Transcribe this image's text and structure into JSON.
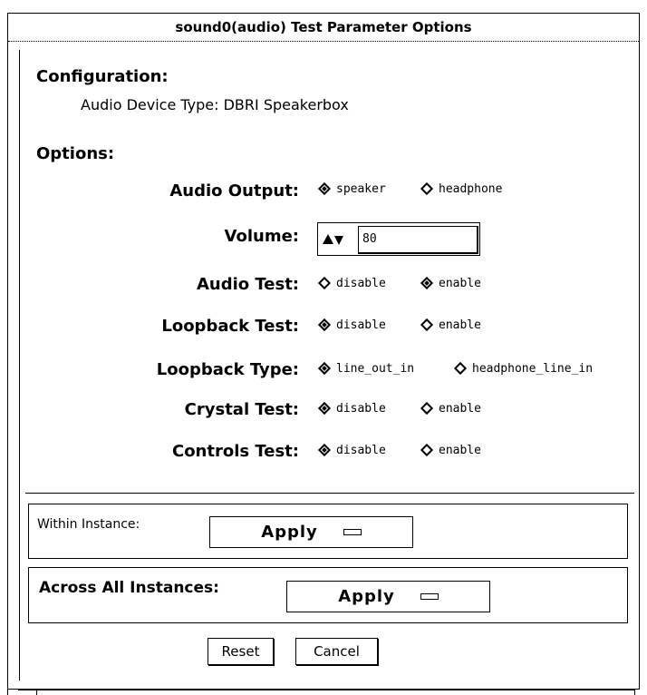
{
  "window": {
    "title": "sound0(audio) Test Parameter Options"
  },
  "configuration": {
    "heading": "Configuration:",
    "device_type": "Audio Device Type: DBRI Speakerbox"
  },
  "options": {
    "heading": "Options:",
    "audio_output": {
      "label": "Audio Output:",
      "choices": [
        "speaker",
        "headphone"
      ],
      "selected": "speaker"
    },
    "volume": {
      "label": "Volume:",
      "value": "80"
    },
    "audio_test": {
      "label": "Audio Test:",
      "choices": [
        "disable",
        "enable"
      ],
      "selected": "enable"
    },
    "loopback_test": {
      "label": "Loopback Test:",
      "choices": [
        "disable",
        "enable"
      ],
      "selected": "disable"
    },
    "loopback_type": {
      "label": "Loopback Type:",
      "choices": [
        "line_out_in",
        "headphone_line_in"
      ],
      "selected": "line_out_in"
    },
    "crystal_test": {
      "label": "Crystal Test:",
      "choices": [
        "disable",
        "enable"
      ],
      "selected": "disable"
    },
    "controls_test": {
      "label": "Controls Test:",
      "choices": [
        "disable",
        "enable"
      ],
      "selected": "disable"
    }
  },
  "within_instance": {
    "label": "Within Instance:",
    "button": "Apply"
  },
  "across_instances": {
    "label": "Across All Instances:",
    "button": "Apply"
  },
  "actions": {
    "reset": "Reset",
    "cancel": "Cancel"
  }
}
